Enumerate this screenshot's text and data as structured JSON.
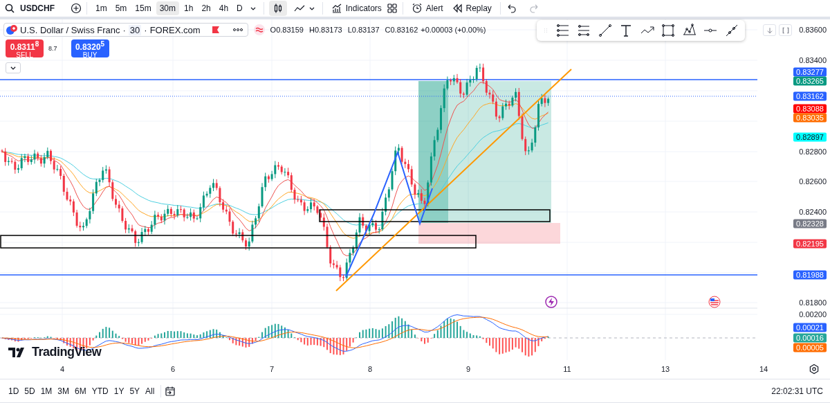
{
  "toolbar": {
    "symbol": "USDCHF",
    "intervals": [
      {
        "label": "1m",
        "selected": false
      },
      {
        "label": "5m",
        "selected": false
      },
      {
        "label": "15m",
        "selected": false
      },
      {
        "label": "30m",
        "selected": true
      },
      {
        "label": "1h",
        "selected": false
      },
      {
        "label": "2h",
        "selected": false
      },
      {
        "label": "4h",
        "selected": false
      },
      {
        "label": "D",
        "selected": false
      }
    ],
    "indicators": "Indicators",
    "alert": "Alert",
    "replay": "Replay"
  },
  "legend": {
    "title": "U.S. Dollar / Swiss Franc",
    "separator": "·",
    "interval": "30",
    "exchange": "FOREX.com",
    "ohlc": [
      "O0.83159",
      "H0.83173",
      "L0.83137",
      "C0.83162"
    ],
    "change": "+0.00003 (+0.00%)"
  },
  "trade": {
    "sell_price": "0.8311$^{8}$",
    "sell_label": "SELL",
    "spread": "8.7",
    "buy_price": "0.8320$^{5}$",
    "buy_label": "BUY"
  },
  "price_axis": [
    {
      "text": "0.83600",
      "kind": "tick"
    },
    {
      "text": "0.83400",
      "kind": "tick"
    },
    {
      "text": "0.83277",
      "kind": "badge",
      "color": "#2962ff"
    },
    {
      "text": "0.83265",
      "kind": "badge",
      "color": "#089981"
    },
    {
      "text": "0.83162",
      "kind": "badge",
      "color": "#2962ff"
    },
    {
      "text": "0.83088",
      "kind": "badge",
      "color": "#ff0000"
    },
    {
      "text": "0.83035",
      "kind": "badge",
      "color": "#ff6d00"
    },
    {
      "text": "0.82897",
      "kind": "badge",
      "color": "#00ffff"
    },
    {
      "text": "0.82800",
      "kind": "tick"
    },
    {
      "text": "0.82600",
      "kind": "tick"
    },
    {
      "text": "0.82400",
      "kind": "tick"
    },
    {
      "text": "0.82328",
      "kind": "badge",
      "color": "#787b86"
    },
    {
      "text": "0.82195",
      "kind": "badge",
      "color": "#f23645"
    },
    {
      "text": "0.81988",
      "kind": "badge",
      "color": "#2962ff"
    },
    {
      "text": "0.81800",
      "kind": "tick"
    }
  ],
  "macd_axis": [
    {
      "text": "0.00200",
      "kind": "tick"
    },
    {
      "text": "0.00021",
      "kind": "badge",
      "color": "#2962ff"
    },
    {
      "text": "0.00016",
      "kind": "badge",
      "color": "#26a69a"
    },
    {
      "text": "0.00005",
      "kind": "badge",
      "color": "#ff6d00"
    }
  ],
  "logo_text": "TradingView",
  "time_axis": [
    "4",
    "6",
    "7",
    "8",
    "9",
    "11",
    "13",
    "14"
  ],
  "ranges": [
    "1D",
    "5D",
    "1M",
    "3M",
    "6M",
    "YTD",
    "1Y",
    "5Y",
    "All"
  ],
  "clock": "22:02:31 UTC"
}
